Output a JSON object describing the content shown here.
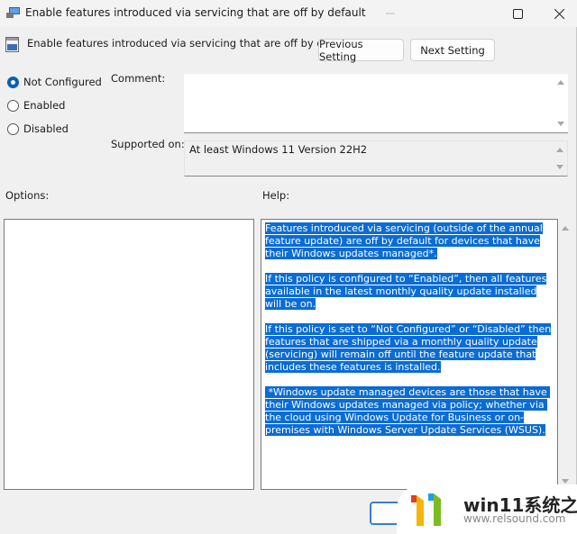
{
  "window": {
    "title": "Enable features introduced via servicing that are off by default",
    "controls": {
      "minimize": "minimize",
      "maximize": "maximize",
      "close": "close"
    }
  },
  "header": {
    "title": "Enable features introduced via servicing that are off by default",
    "previous_label": "Previous Setting",
    "next_label": "Next Setting"
  },
  "state": {
    "options": [
      {
        "label": "Not Configured",
        "selected": true
      },
      {
        "label": "Enabled",
        "selected": false
      },
      {
        "label": "Disabled",
        "selected": false
      }
    ]
  },
  "comment": {
    "label": "Comment:",
    "value": ""
  },
  "supported": {
    "label": "Supported on:",
    "value": "At least Windows 11 Version 22H2"
  },
  "options_label": "Options:",
  "help": {
    "label": "Help:",
    "paragraphs": [
      "Features introduced via servicing (outside of the annual feature update) are off by default for devices that have their Windows updates managed*.",
      "If this policy is configured to “Enabled”, then all features available in the latest monthly quality update installed will be on.",
      "If this policy is set to “Not Configured” or “Disabled” then features that are shipped via a monthly quality update (servicing) will remain off until the feature update that includes these features is installed.",
      " *Windows update managed devices are those that have their Windows updates managed via policy; whether via the cloud using Windows Update for Business or on-premises with Windows Server Update Services (WSUS)."
    ]
  },
  "watermark": {
    "title": "win11系统之家",
    "url": "www.relsound.com"
  },
  "colors": {
    "accent": "#0a5fb8",
    "selection": "#0a6cd6"
  }
}
